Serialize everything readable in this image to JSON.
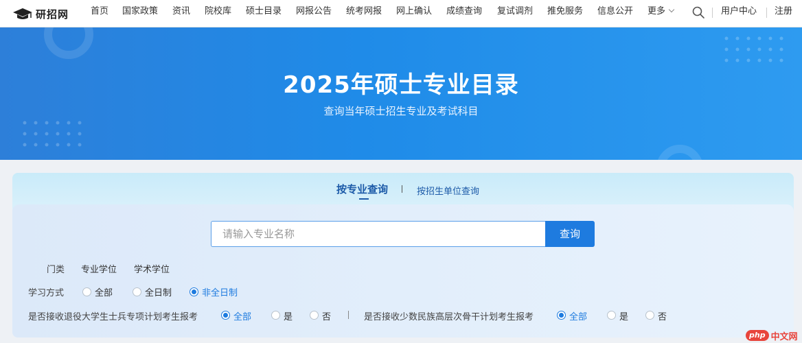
{
  "site": {
    "logo_text": "研招网"
  },
  "nav": {
    "items": [
      "首页",
      "国家政策",
      "资讯",
      "院校库",
      "硕士目录",
      "网报公告",
      "统考网报",
      "网上确认",
      "成绩查询",
      "复试调剂",
      "推免服务",
      "信息公开"
    ],
    "more": "更多",
    "user_center": "用户中心",
    "register": "注册"
  },
  "banner": {
    "title": "2025年硕士专业目录",
    "subtitle": "查询当年硕士招生专业及考试科目"
  },
  "tabs": {
    "active": "按专业查询",
    "inactive": "按招生单位查询"
  },
  "search": {
    "placeholder": "请输入专业名称",
    "button": "查询"
  },
  "filters": {
    "category_label": "门类",
    "category_options": [
      "专业学位",
      "学术学位"
    ],
    "study_label": "学习方式",
    "study_options": [
      "全部",
      "全日制",
      "非全日制"
    ],
    "study_selected": "非全日制",
    "veteran_label": "是否接收退役大学生士兵专项计划考生报考",
    "veteran_options": [
      "全部",
      "是",
      "否"
    ],
    "veteran_selected": "全部",
    "minority_label": "是否接收少数民族高层次骨干计划考生报考",
    "minority_options": [
      "全部",
      "是",
      "否"
    ],
    "minority_selected": "全部"
  },
  "watermark": {
    "badge": "php",
    "text": "中文网"
  },
  "colors": {
    "primary": "#1e7bdf",
    "banner_start": "#2d7fd9",
    "banner_end": "#2e9bf0",
    "tab_text": "#1c5aa8",
    "watermark": "#e8453c"
  }
}
